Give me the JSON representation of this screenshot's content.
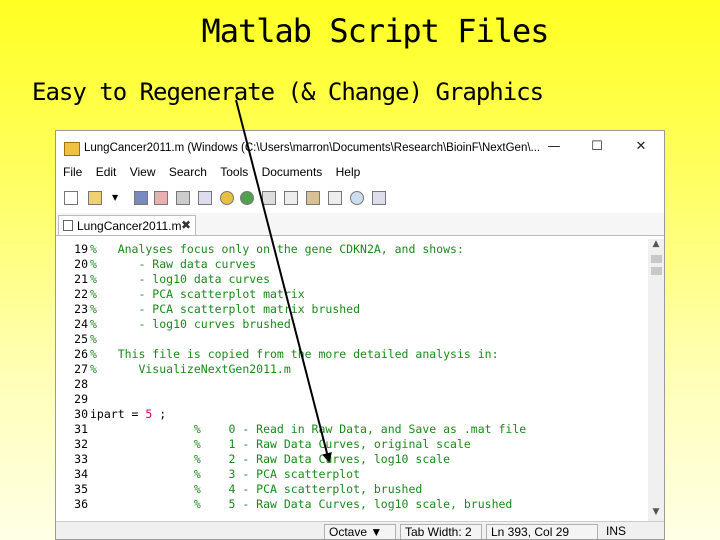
{
  "slide": {
    "title": "Matlab Script Files",
    "subtitle": "Easy to Regenerate (& Change) Graphics"
  },
  "window": {
    "title": "LungCancer2011.m (Windows (C:\\Users\\marron\\Documents\\Research\\BioinF\\NextGen\\...",
    "minimize": "—",
    "maximize": "☐",
    "close": "✕"
  },
  "menu": [
    "File",
    "Edit",
    "View",
    "Search",
    "Tools",
    "Documents",
    "Help"
  ],
  "tab": {
    "label": "LungCancer2011.m",
    "close": "✖"
  },
  "code": {
    "lines": [
      {
        "no": "19",
        "segs": [
          {
            "t": "%   Analyses focus only on the gene CDKN2A, and shows:",
            "c": "comment"
          }
        ]
      },
      {
        "no": "20",
        "segs": [
          {
            "t": "%      - Raw data curves",
            "c": "comment"
          }
        ]
      },
      {
        "no": "21",
        "segs": [
          {
            "t": "%      - log10 data curves",
            "c": "comment"
          }
        ]
      },
      {
        "no": "22",
        "segs": [
          {
            "t": "%      - PCA scatterplot matrix",
            "c": "comment"
          }
        ]
      },
      {
        "no": "23",
        "segs": [
          {
            "t": "%      - PCA scatterplot matrix brushed",
            "c": "comment"
          }
        ]
      },
      {
        "no": "24",
        "segs": [
          {
            "t": "%      - log10 curves brushed",
            "c": "comment"
          }
        ]
      },
      {
        "no": "25",
        "segs": [
          {
            "t": "%",
            "c": "comment"
          }
        ]
      },
      {
        "no": "26",
        "segs": [
          {
            "t": "%   This file is copied from the more detailed analysis in:",
            "c": "comment"
          }
        ]
      },
      {
        "no": "27",
        "segs": [
          {
            "t": "%      VisualizeNextGen2011.m",
            "c": "comment"
          }
        ]
      },
      {
        "no": "28",
        "segs": []
      },
      {
        "no": "29",
        "segs": []
      },
      {
        "no": "30",
        "segs": [
          {
            "t": "ipart = ",
            "c": "kw"
          },
          {
            "t": "5",
            "c": "num"
          },
          {
            "t": " ;",
            "c": "kw"
          }
        ]
      },
      {
        "no": "31",
        "segs": [
          {
            "t": "               %    0 - Read in Raw Data, and Save as .mat file",
            "c": "comment"
          }
        ]
      },
      {
        "no": "32",
        "segs": [
          {
            "t": "               %    1 - Raw Data Curves, original scale",
            "c": "comment"
          }
        ]
      },
      {
        "no": "33",
        "segs": [
          {
            "t": "               %    2 - Raw Data Curves, log10 scale",
            "c": "comment"
          }
        ]
      },
      {
        "no": "34",
        "segs": [
          {
            "t": "               %    3 - PCA scatterplot",
            "c": "comment"
          }
        ]
      },
      {
        "no": "35",
        "segs": [
          {
            "t": "               %    4 - PCA scatterplot, brushed",
            "c": "comment"
          }
        ]
      },
      {
        "no": "36",
        "segs": [
          {
            "t": "               %    5 - Raw Data Curves, log10 scale, brushed",
            "c": "comment"
          }
        ]
      }
    ]
  },
  "scroll": {
    "up": "▲",
    "down": "▼"
  },
  "status": {
    "language": "Octave ▼",
    "tab_width": "Tab Width: 2 ▼",
    "position": "Ln 393, Col 29",
    "mode": "INS"
  },
  "colors": {
    "comment": "#1a8a1a",
    "number": "#e0006a",
    "arrow": "#000000"
  }
}
